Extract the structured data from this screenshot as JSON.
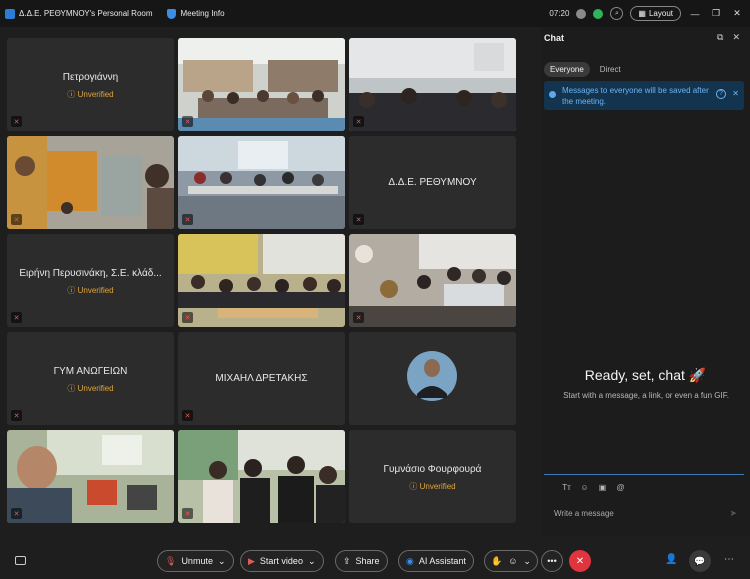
{
  "titlebar": {
    "room_name": "Δ.Δ.Ε. ΡΕΘΥΜΝΟΥ's Personal Room",
    "meeting_info": "Meeting Info",
    "time": "07:20",
    "layout_label": "Layout"
  },
  "tiles": [
    {
      "name": "Πετρογιάννη",
      "status": "Unverified",
      "video": false
    },
    {
      "name": "",
      "status": "",
      "video": true,
      "scene": "library"
    },
    {
      "name": "",
      "status": "",
      "video": true,
      "scene": "classroom-dark"
    },
    {
      "name": "",
      "status": "",
      "video": true,
      "scene": "office-cabinets"
    },
    {
      "name": "",
      "status": "",
      "video": true,
      "scene": "computer-lab"
    },
    {
      "name": "Δ.Δ.Ε. ΡΕΘΥΜΝΟΥ",
      "status": "",
      "video": false
    },
    {
      "name": "Ειρήνη Περυσινάκη, Σ.Ε. κλάδ...",
      "status": "Unverified",
      "video": false
    },
    {
      "name": "",
      "status": "",
      "video": true,
      "scene": "classroom-yellow"
    },
    {
      "name": "",
      "status": "",
      "video": true,
      "scene": "classroom-tables"
    },
    {
      "name": "ΓΥΜ ΑΝΩΓΕΙΩΝ",
      "status": "Unverified",
      "video": false
    },
    {
      "name": "ΜΙΧΑΗΛ ΔΡΕΤΑΚΗΣ",
      "status": "",
      "video": false
    },
    {
      "name": "",
      "status": "",
      "video": false,
      "avatar": true
    },
    {
      "name": "",
      "status": "",
      "video": true,
      "scene": "teacher-room"
    },
    {
      "name": "",
      "status": "",
      "video": true,
      "scene": "students-group"
    },
    {
      "name": "Γυμνάσιο Φουρφουρά",
      "status": "Unverified",
      "video": false
    }
  ],
  "chat": {
    "title": "Chat",
    "tabs": [
      "Everyone",
      "Direct"
    ],
    "notice": "Messages to everyone will be saved after the meeting.",
    "ready_title": "Ready, set, chat 🚀",
    "ready_sub": "Start with a message, a link, or even a fun GIF.",
    "input_placeholder": "Write a message"
  },
  "controls": {
    "unmute": "Unmute",
    "start_video": "Start video",
    "share": "Share",
    "ai_assistant": "AI Assistant"
  },
  "colors": {
    "unverified": "#e0a43a",
    "end_call": "#e0343f",
    "notice_bg": "#13344f"
  }
}
